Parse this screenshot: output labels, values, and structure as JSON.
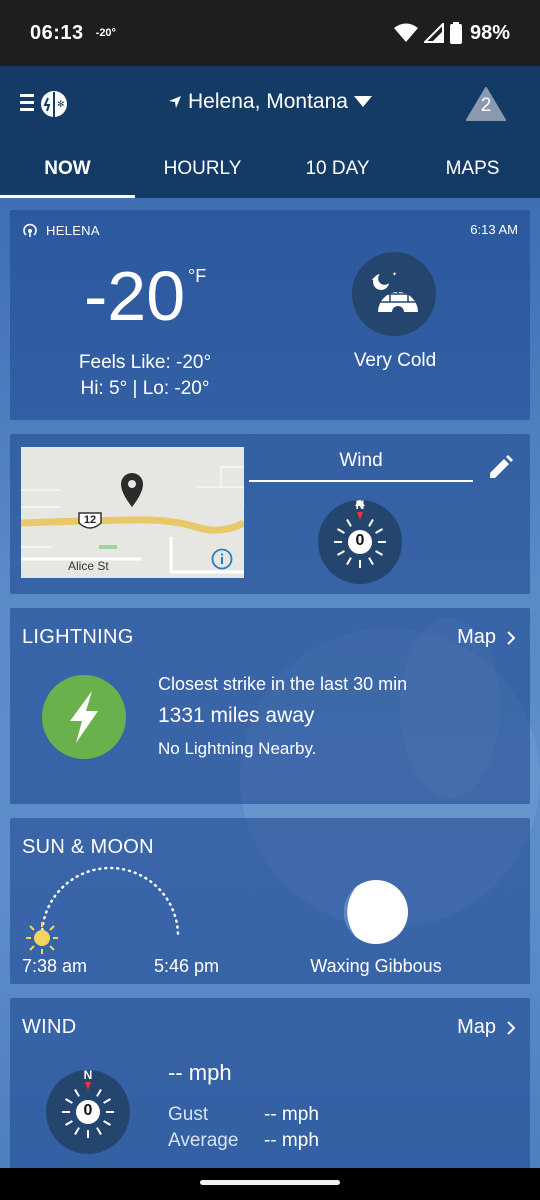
{
  "status_bar": {
    "time": "06:13",
    "temp": "-20°",
    "battery": "98%"
  },
  "header": {
    "location": "Helena, Montana",
    "alert_count": "2",
    "tabs": [
      {
        "label": "NOW",
        "active": true
      },
      {
        "label": "HOURLY"
      },
      {
        "label": "10 DAY"
      },
      {
        "label": "MAPS"
      }
    ]
  },
  "current": {
    "station": "HELENA",
    "obs_time": "6:13 AM",
    "temperature": "-20",
    "unit": "°F",
    "feels_like": "Feels Like: -20°",
    "hi_lo": "Hi: 5° | Lo: -20°",
    "condition": "Very Cold",
    "condition_icon": "igloo-moon-icon"
  },
  "map_card": {
    "street": "Alice St",
    "route_number": "12",
    "wind_tab": "Wind",
    "compass_value": "0",
    "compass_north": "N"
  },
  "lightning": {
    "title": "LIGHTNING",
    "map_label": "Map",
    "closest_label": "Closest strike in the last 30 min",
    "distance": "1331 miles away",
    "status": "No Lightning Nearby.",
    "icon_color": "#6ab04c"
  },
  "sun_moon": {
    "title": "SUN & MOON",
    "sunrise": "7:38 am",
    "sunset": "5:46 pm",
    "moon_phase": "Waxing Gibbous"
  },
  "wind": {
    "title": "WIND",
    "map_label": "Map",
    "speed": "-- mph",
    "gust_label": "Gust",
    "gust_value": "-- mph",
    "avg_label": "Average",
    "avg_value": "-- mph",
    "compass_value": "0",
    "compass_north": "N"
  },
  "colors": {
    "appbar": "#143b66",
    "compass_bg": "#24456e",
    "needle": "#e53935",
    "sun": "#f4d35e"
  }
}
